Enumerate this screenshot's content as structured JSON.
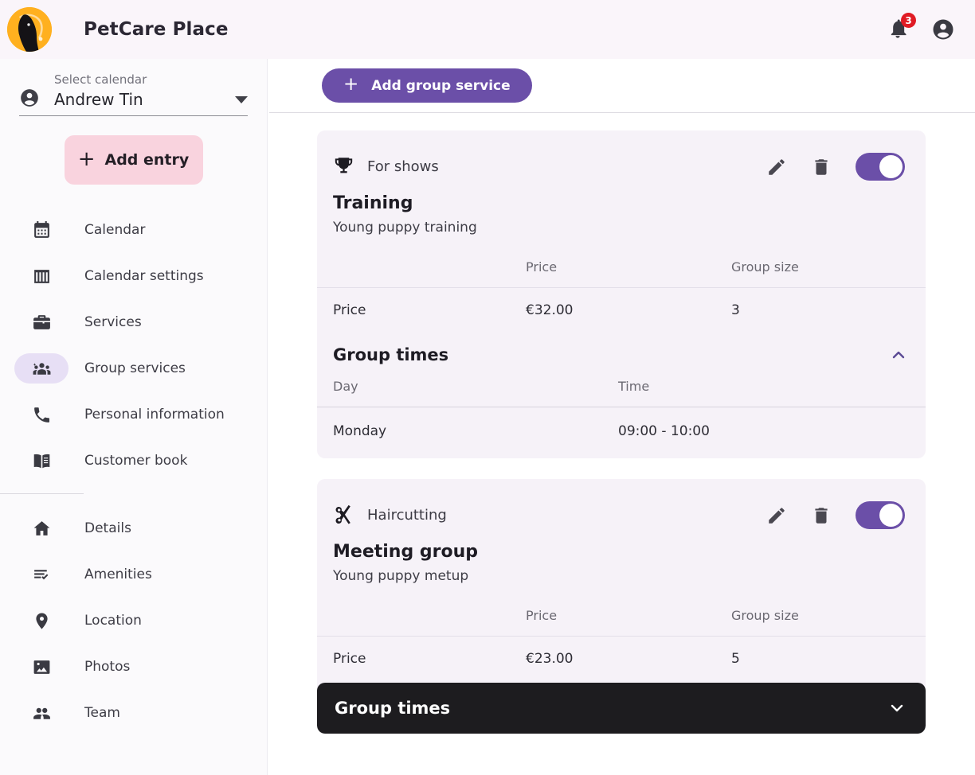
{
  "header": {
    "brand": "PetCare Place",
    "logo_icon": "dog-logo-icon",
    "bell_icon": "bell-icon",
    "notification_count": "3",
    "avatar_icon": "account-circle-icon"
  },
  "sidebar": {
    "calendar_select": {
      "label": "Select calendar",
      "value": "Andrew Tin",
      "person_icon": "account-circle-icon",
      "caret_icon": "chevron-down-icon"
    },
    "add_entry": {
      "label": "Add entry",
      "plus": "+"
    },
    "nav_primary": [
      {
        "label": "Calendar",
        "icon": "calendar-icon",
        "active": false
      },
      {
        "label": "Calendar settings",
        "icon": "calendar-settings-icon",
        "active": false
      },
      {
        "label": "Services",
        "icon": "toolbox-icon",
        "active": false
      },
      {
        "label": "Group services",
        "icon": "group-people-icon",
        "active": true
      },
      {
        "label": "Personal information",
        "icon": "phone-icon",
        "active": false
      },
      {
        "label": "Customer book",
        "icon": "book-icon",
        "active": false
      }
    ],
    "nav_secondary": [
      {
        "label": "Details",
        "icon": "home-icon"
      },
      {
        "label": "Amenities",
        "icon": "list-check-icon"
      },
      {
        "label": "Location",
        "icon": "map-pin-icon"
      },
      {
        "label": "Photos",
        "icon": "photo-icon"
      },
      {
        "label": "Team",
        "icon": "people-icon"
      }
    ]
  },
  "main": {
    "add_group_service": {
      "label": "Add group service",
      "plus": "+"
    },
    "table_headers": {
      "blank": "",
      "price": "Price",
      "group_size": "Group size"
    },
    "group_times_headers": {
      "day": "Day",
      "time": "Time"
    },
    "cards": [
      {
        "category": "For shows",
        "category_icon": "trophy-icon",
        "edit_icon": "pencil-icon",
        "delete_icon": "trash-icon",
        "toggle_on": true,
        "title": "Training",
        "subtitle": "Young puppy training",
        "row_label": "Price",
        "price": "€32.00",
        "group_size": "3",
        "group_times_label": "Group times",
        "group_times_expanded": true,
        "chevron_icon": "chevron-up-icon",
        "times": [
          {
            "day": "Monday",
            "time": "09:00 - 10:00"
          }
        ]
      },
      {
        "category": "Haircutting",
        "category_icon": "scissors-icon",
        "edit_icon": "pencil-icon",
        "delete_icon": "trash-icon",
        "toggle_on": true,
        "title": "Meeting group",
        "subtitle": "Young puppy metup",
        "row_label": "Price",
        "price": "€23.00",
        "group_size": "5",
        "group_times_label": "Group times",
        "group_times_expanded": false,
        "chevron_icon": "chevron-down-icon",
        "times": []
      }
    ]
  },
  "colors": {
    "accent_purple": "#6b4fa8",
    "accent_pink": "#f9d3de",
    "card_bg": "#f6f2f8",
    "active_pill": "#e7dff5",
    "badge_red": "#e01b24",
    "dark_bar": "#1d1c1f"
  }
}
